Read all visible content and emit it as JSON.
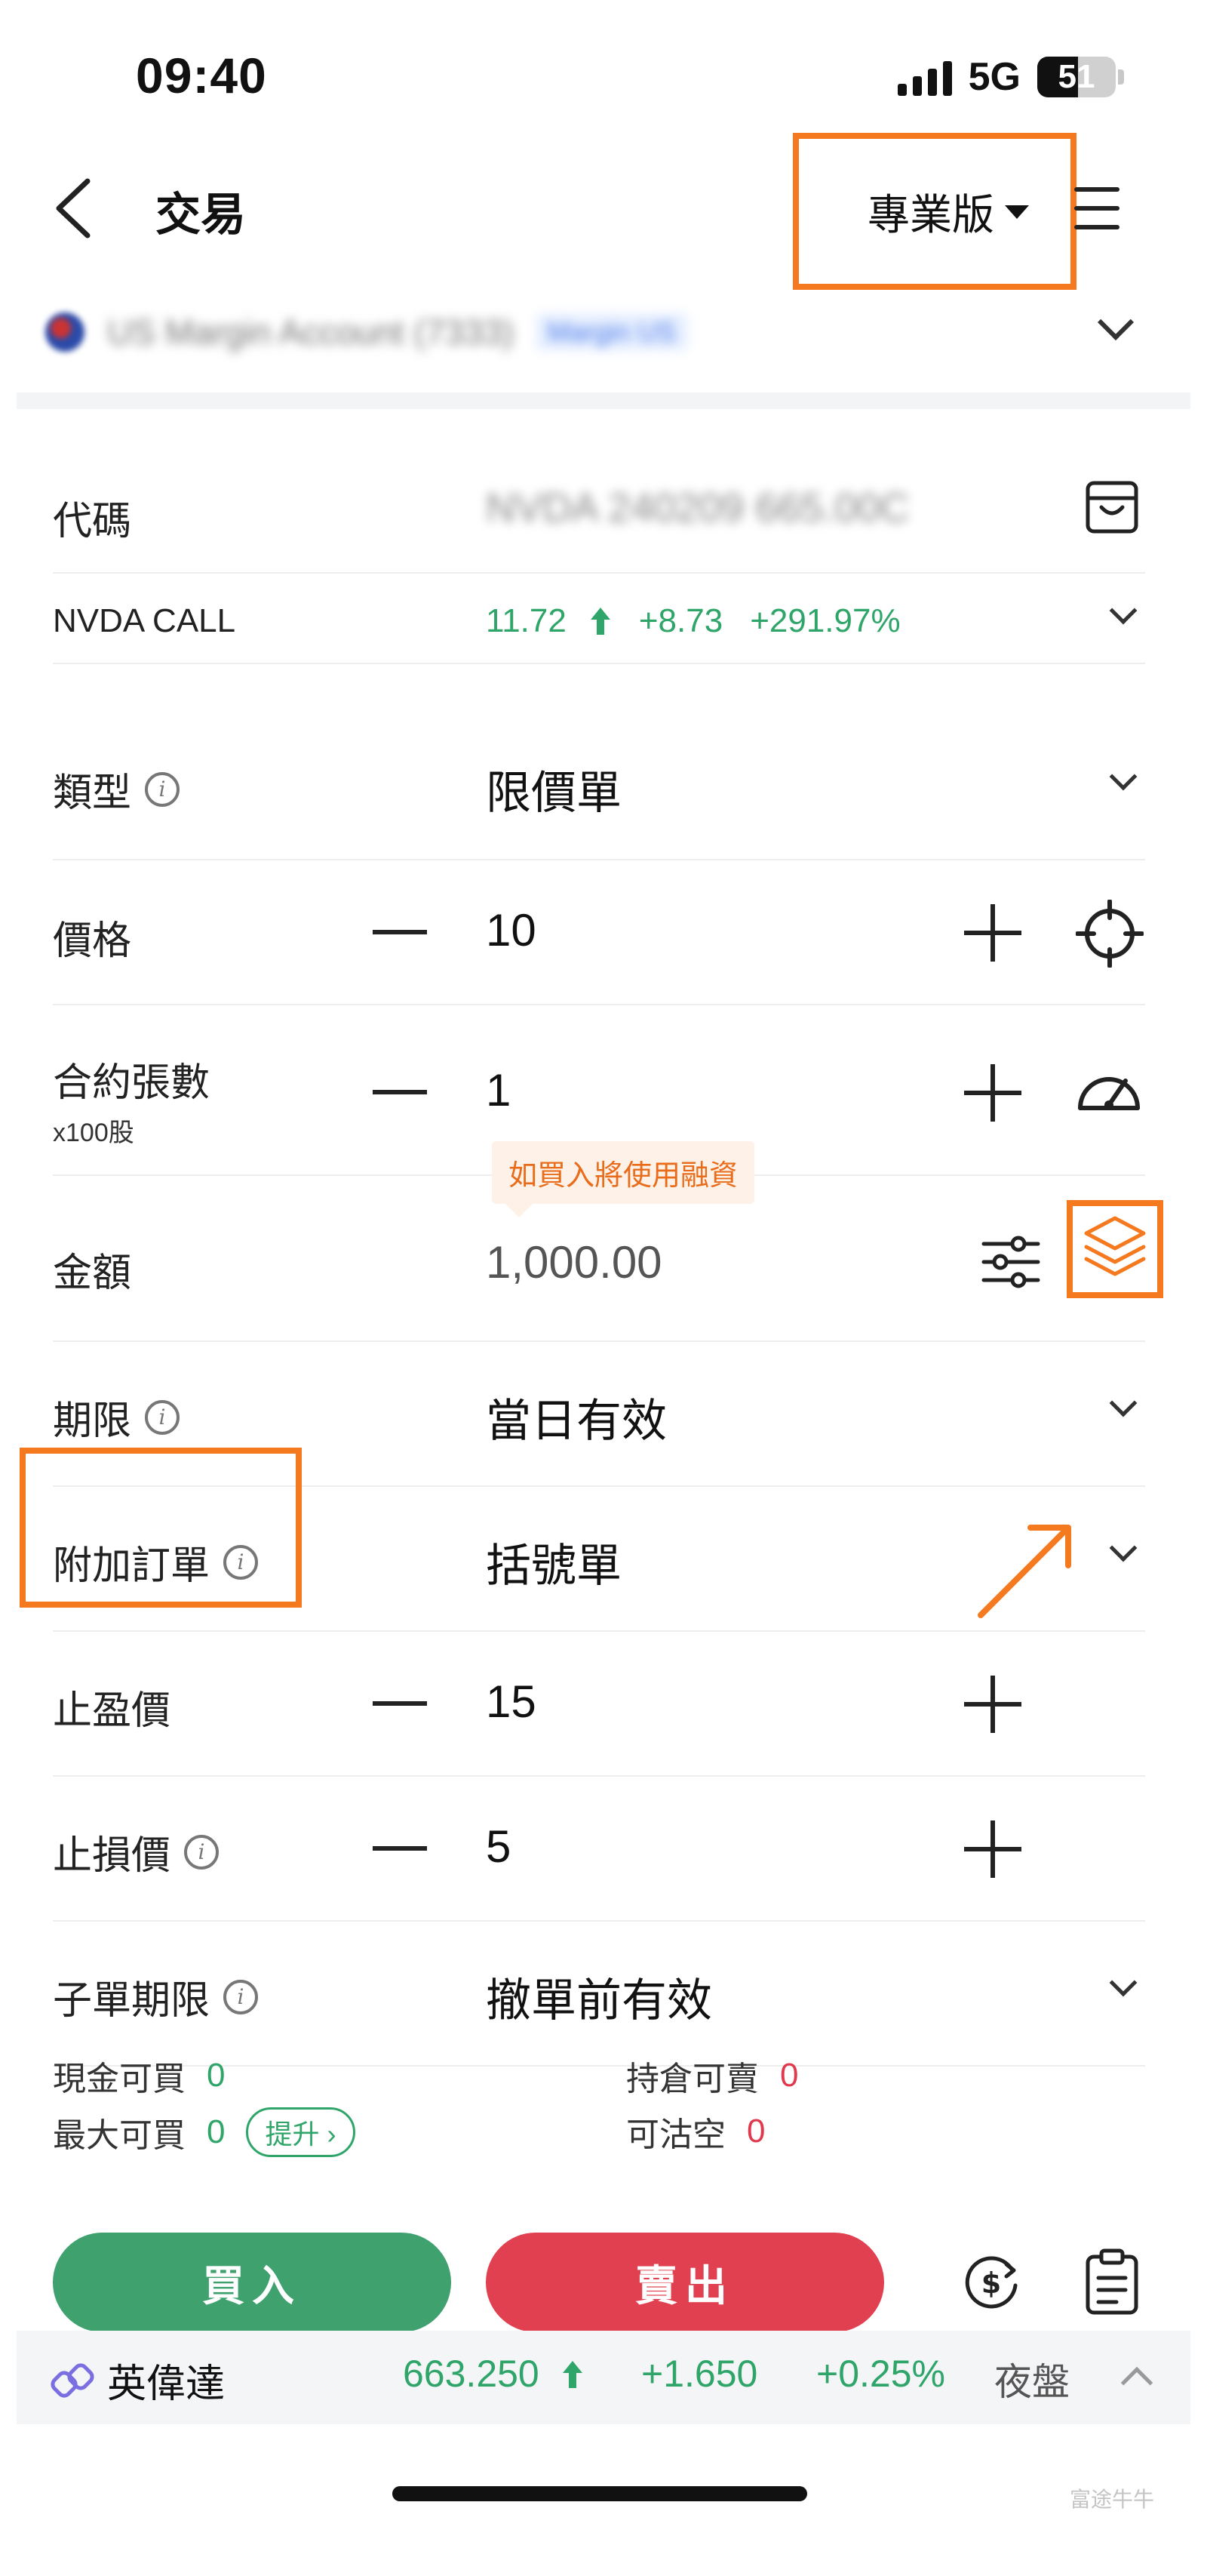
{
  "status_bar": {
    "time": "09:40",
    "network": "5G",
    "battery": "51"
  },
  "nav": {
    "title": "交易",
    "version_label": "專業版"
  },
  "account": {
    "name": "US Margin Account (7333)",
    "tag": "Margin US"
  },
  "symbol_row": {
    "label": "代碼",
    "value": "NVDA 240209 665.00C"
  },
  "quote_row": {
    "label": "NVDA CALL",
    "price": "11.72",
    "change": "+8.73",
    "change_pct": "+291.97%"
  },
  "order": {
    "type": {
      "label": "類型",
      "value": "限價單"
    },
    "price": {
      "label": "價格",
      "value": "10"
    },
    "contracts": {
      "label": "合約張數",
      "sublabel": "x100股",
      "value": "1"
    },
    "amount": {
      "label": "金額",
      "value": "1,000.00",
      "tooltip": "如買入將使用融資"
    },
    "duration": {
      "label": "期限",
      "value": "當日有效"
    },
    "attached": {
      "label": "附加訂單",
      "value": "括號單"
    },
    "take_profit": {
      "label": "止盈價",
      "value": "15"
    },
    "stop_loss": {
      "label": "止損價",
      "value": "5"
    },
    "child_duration": {
      "label": "子單期限",
      "value": "撤單前有效"
    }
  },
  "buying_power": {
    "cash_buy_label": "現金可買",
    "cash_buy_value": "0",
    "max_buy_label": "最大可買",
    "max_buy_value": "0",
    "upgrade_label": "提升",
    "position_sell_label": "持倉可賣",
    "position_sell_value": "0",
    "short_label": "可沽空",
    "short_value": "0"
  },
  "actions": {
    "buy_label": "買入",
    "sell_label": "賣出"
  },
  "ticker": {
    "name": "英偉達",
    "price": "663.250",
    "change": "+1.650",
    "change_pct": "+0.25%",
    "session": "夜盤"
  },
  "watermark": "富途牛牛",
  "colors": {
    "accent": "#f57a1f",
    "up": "#2fa56a",
    "down": "#e0394d",
    "buy": "#3ea16e",
    "sell": "#e0404f"
  },
  "icons": [
    "back-icon",
    "menu-icon",
    "watchlist-box-icon",
    "crosshair-icon",
    "speedometer-icon",
    "sliders-icon",
    "layers-icon",
    "info-icon",
    "chevron-down-icon",
    "currency-exchange-icon",
    "clipboard-icon",
    "link-icon",
    "chevron-up-icon"
  ]
}
